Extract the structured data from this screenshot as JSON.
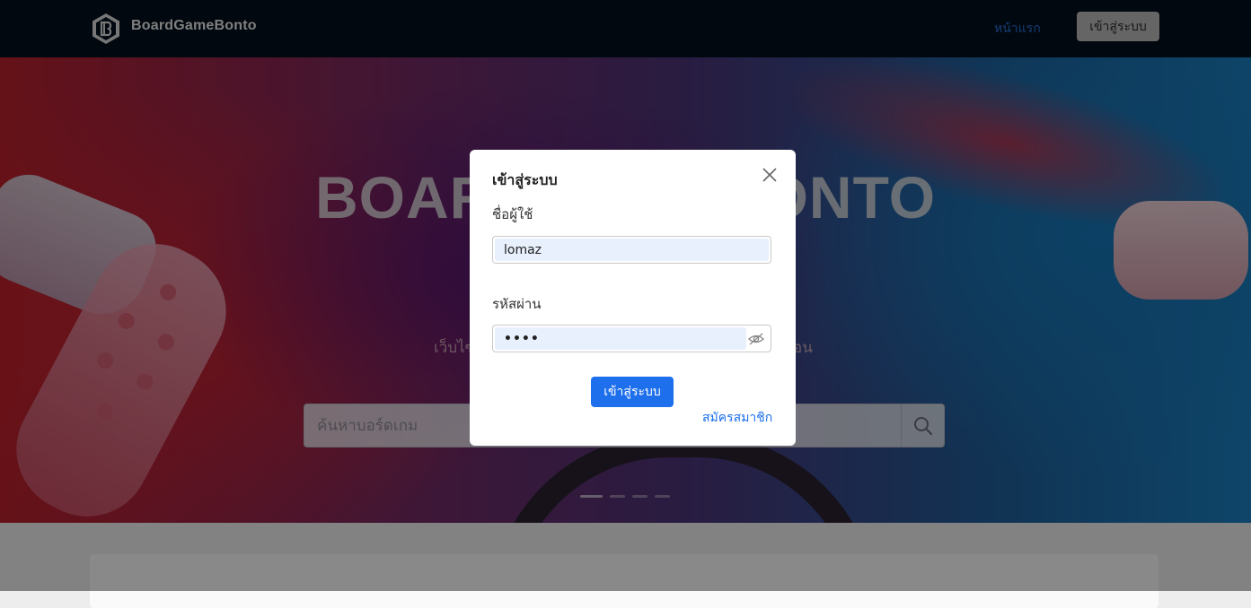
{
  "navbar": {
    "brand": "BoardGameBonto",
    "home_link": "หน้าแรก",
    "login_button": "เข้าสู่ระบบ"
  },
  "hero": {
    "title": "BOARDGAMEBONTO",
    "subtitle": "เว็บไซ",
    "subtitle_suffix": "อน",
    "search_placeholder": "ค้นหาบอร์ดเกม",
    "carousel_dots": 4,
    "carousel_active": 1
  },
  "modal": {
    "title": "เข้าสู่ระบบ",
    "username_label": "ชื่อผู้ใช้",
    "username_value": "lomaz",
    "password_label": "รหัสผ่าน",
    "password_value": "••••",
    "submit_label": "เข้าสู่ระบบ",
    "register_link": "สมัครสมาชิก"
  },
  "colors": {
    "navbar_bg": "#03101e",
    "primary": "#1d6fec",
    "link": "#2a6fd6"
  },
  "icons": [
    "logo-icon",
    "search-icon",
    "close-icon",
    "eye-off-icon"
  ]
}
